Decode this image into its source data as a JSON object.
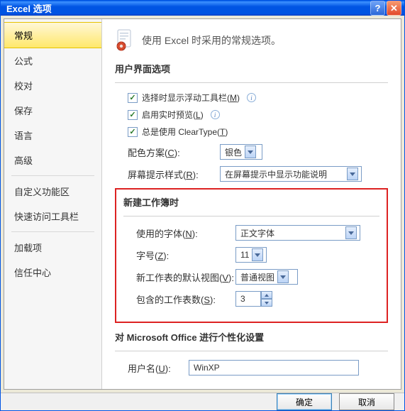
{
  "window": {
    "title": "Excel 选项"
  },
  "sidebar": {
    "items": [
      {
        "label": "常规",
        "selected": true
      },
      {
        "label": "公式"
      },
      {
        "label": "校对"
      },
      {
        "label": "保存"
      },
      {
        "label": "语言"
      },
      {
        "label": "高级"
      },
      {
        "sep": true
      },
      {
        "label": "自定义功能区"
      },
      {
        "label": "快速访问工具栏"
      },
      {
        "sep": true
      },
      {
        "label": "加载项"
      },
      {
        "label": "信任中心"
      }
    ]
  },
  "header": {
    "text": "使用 Excel 时采用的常规选项。"
  },
  "ui_section": {
    "title": "用户界面选项",
    "check_minitoolbar": "选择时显示浮动工具栏(",
    "check_minitoolbar_key": "M",
    "check_minitoolbar_end": ")",
    "check_livepreview": "启用实时预览(",
    "check_livepreview_key": "L",
    "check_livepreview_end": ")",
    "check_cleartype": "总是使用 ClearType(",
    "check_cleartype_key": "T",
    "check_cleartype_end": ")",
    "color_label": "配色方案(",
    "color_key": "C",
    "color_end": "):",
    "color_value": "银色",
    "screentip_label": "屏幕提示样式(",
    "screentip_key": "R",
    "screentip_end": "):",
    "screentip_value": "在屏幕提示中显示功能说明"
  },
  "newbook": {
    "title": "新建工作簿时",
    "font_label": "使用的字体(",
    "font_key": "N",
    "font_end": "):",
    "font_value": "正文字体",
    "size_label": "字号(",
    "size_key": "Z",
    "size_end": "):",
    "size_value": "11",
    "view_label": "新工作表的默认视图(",
    "view_key": "V",
    "view_end": "):",
    "view_value": "普通视图",
    "sheets_label": "包含的工作表数(",
    "sheets_key": "S",
    "sheets_end": "):",
    "sheets_value": "3"
  },
  "personalize": {
    "title": "对 Microsoft Office 进行个性化设置",
    "username_label": "用户名(",
    "username_key": "U",
    "username_end": "):",
    "username_value": "WinXP"
  },
  "footer": {
    "ok": "确定",
    "cancel": "取消"
  }
}
